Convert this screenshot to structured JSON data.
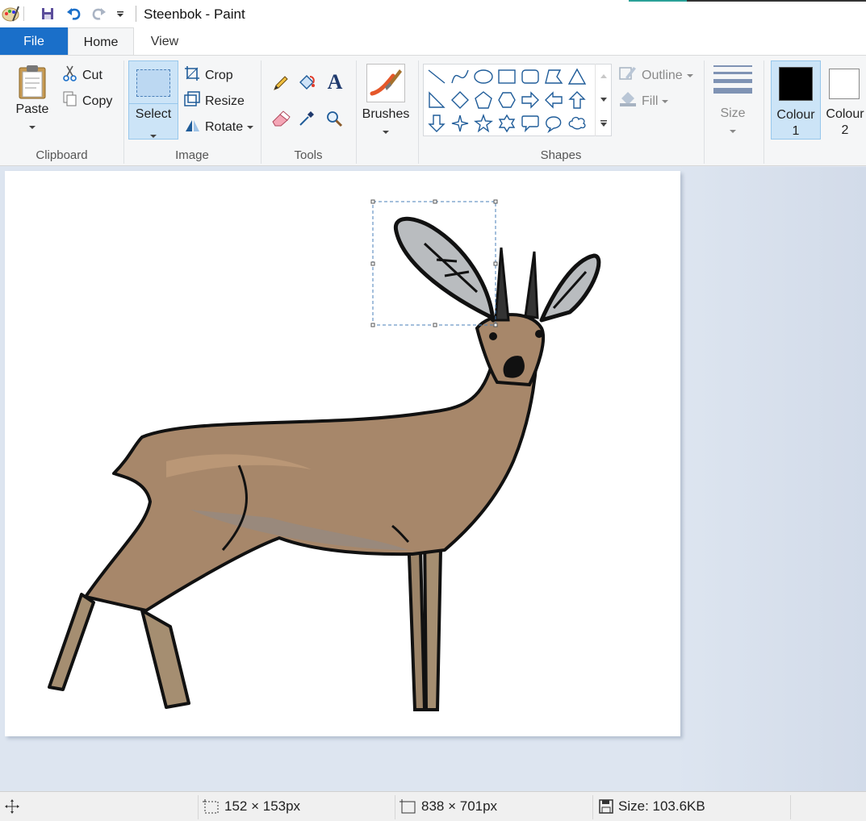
{
  "window": {
    "title": "Steenbok - Paint"
  },
  "quick_access": {
    "icons": [
      "paint-app-icon",
      "save-icon",
      "undo-icon",
      "redo-icon",
      "customize-qat-icon"
    ]
  },
  "tabs": [
    {
      "label": "File"
    },
    {
      "label": "Home"
    },
    {
      "label": "View"
    }
  ],
  "ribbon": {
    "clipboard": {
      "label": "Clipboard",
      "paste": "Paste",
      "cut": "Cut",
      "copy": "Copy"
    },
    "image": {
      "label": "Image",
      "select": "Select",
      "crop": "Crop",
      "resize": "Resize",
      "rotate": "Rotate"
    },
    "tools": {
      "label": "Tools",
      "items": [
        "pencil-icon",
        "fill-bucket-icon",
        "text-icon",
        "eraser-icon",
        "color-picker-icon",
        "magnifier-icon"
      ]
    },
    "brushes": {
      "label": "Brushes"
    },
    "shapes": {
      "label": "Shapes",
      "outline": "Outline",
      "fill": "Fill",
      "items": [
        "line",
        "curve",
        "oval",
        "rectangle",
        "rounded-rectangle",
        "polygon",
        "triangle",
        "right-triangle",
        "diamond",
        "pentagon",
        "hexagon",
        "right-arrow",
        "left-arrow",
        "up-arrow",
        "down-arrow",
        "four-point-star",
        "five-point-star",
        "six-point-star",
        "rounded-callout",
        "oval-callout",
        "cloud-callout"
      ]
    },
    "size": {
      "label": "Size"
    },
    "colour1": {
      "label_line1": "Colour",
      "label_line2": "1",
      "color": "#000000"
    },
    "colour2": {
      "label_line1": "Colour",
      "label_line2": "2",
      "color": "#ffffff"
    }
  },
  "canvas": {
    "image_subject": "steenbok-antelope-drawing"
  },
  "status": {
    "selection_size": "152 × 153px",
    "image_size": "838 × 701px",
    "file_size": "Size: 103.6KB"
  },
  "colors": {
    "file_tab": "#1a6fc9",
    "selected": "#cce4f7",
    "accent_teal": "#2aa198"
  }
}
